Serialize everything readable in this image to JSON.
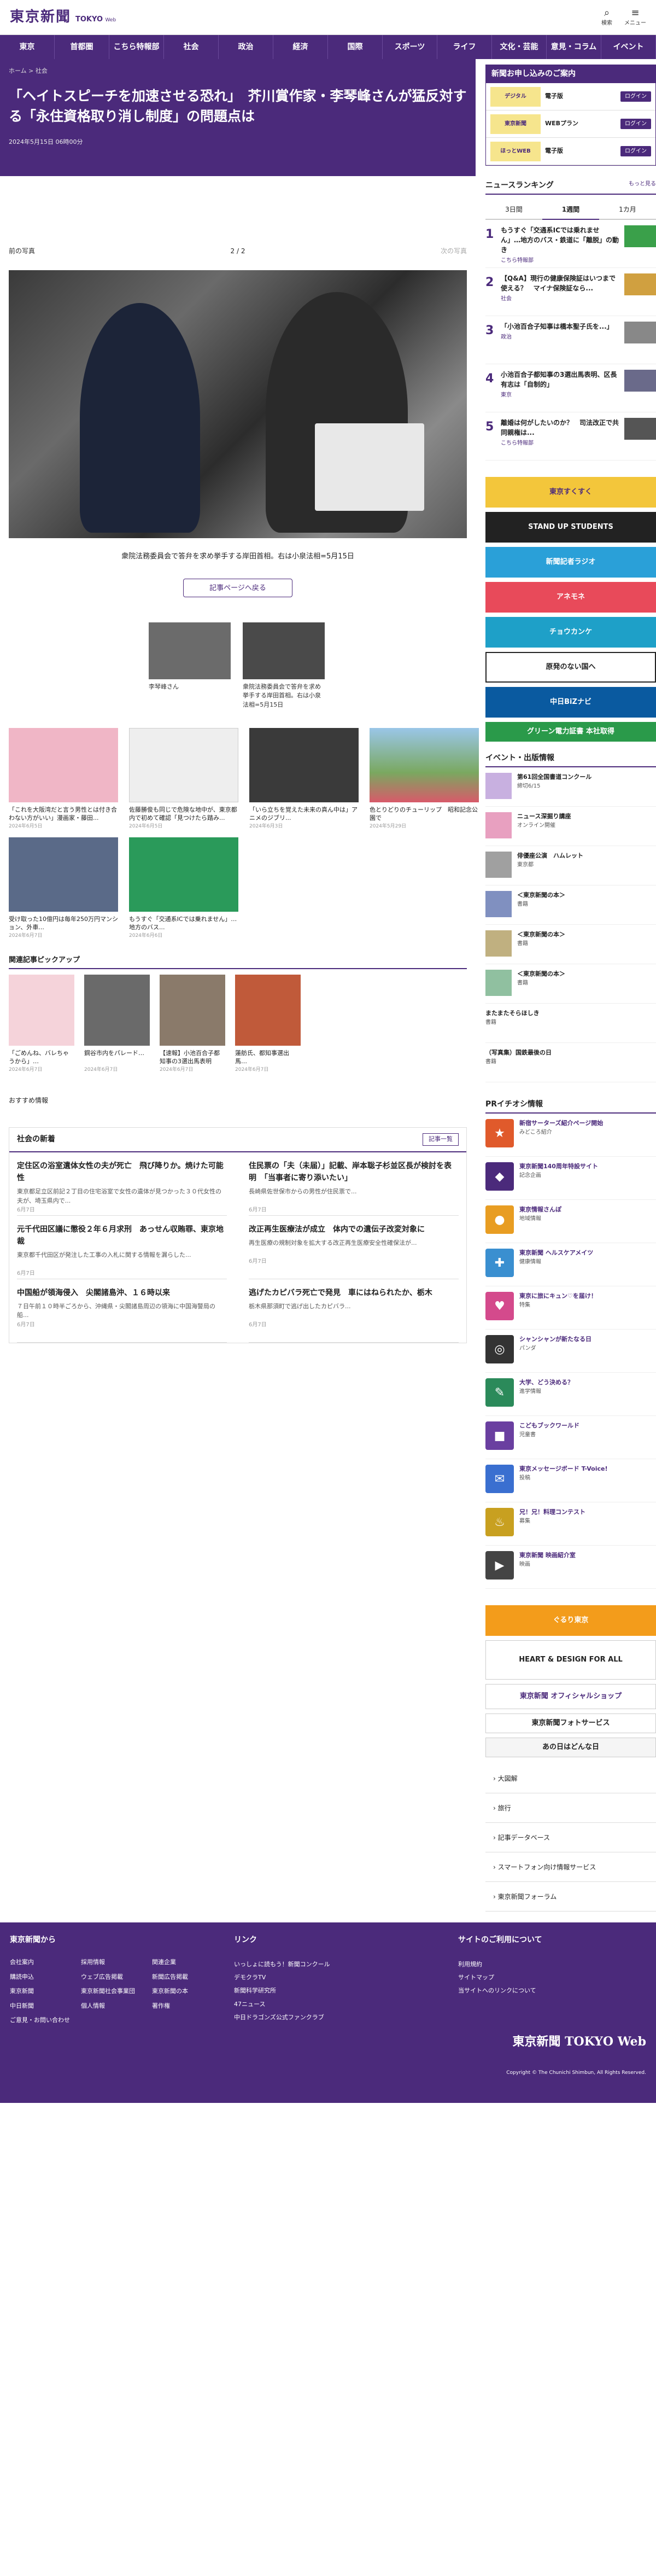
{
  "header": {
    "logo_jp": "東京新聞",
    "logo_en": "TOKYO",
    "logo_en_small": "Web",
    "search_label": "検索",
    "menu_label": "メニュー"
  },
  "nav": [
    "東京",
    "首都圏",
    "こちら特報部",
    "社会",
    "政治",
    "経済",
    "国際",
    "スポーツ",
    "ライフ",
    "文化・芸能",
    "意見・コラム",
    "イベント"
  ],
  "article": {
    "breadcrumb": "ホーム > 社会",
    "title": "「ヘイトスピーチを加速させる恐れ」　芥川賞作家・李琴峰さんが猛反対する「永住資格取り消し制度」の問題点は",
    "date": "2024年5月15日 06時00分",
    "prev": "前の写真",
    "page": "2 / 2",
    "next": "次の写真",
    "caption": "衆院法務委員会で答弁を求め挙手する岸田首相。右は小泉法相=5月15日",
    "back": "記事ページへ戻る"
  },
  "thumbs": [
    {
      "text": "李琴峰さん"
    },
    {
      "text": "衆院法務委員会で答弁を求め挙手する岸田首相。右は小泉法相=5月15日"
    }
  ],
  "related": [
    {
      "text": "「これを大阪湾だと言う男性とは付き合わない方がいい」漫画家・藤田...",
      "date": "2024年6月5日"
    },
    {
      "text": "佐藤勝俊も同じで危険な地中が、東京都内で初めて確認「見つけたら踏み...",
      "date": "2024年6月5日"
    },
    {
      "text": "「いら立ちを覚えた未来の真ん中は」アニメのジブリ...",
      "date": "2024年6月3日"
    },
    {
      "text": "色とりどりのチューリップ　昭和記念公園で",
      "date": "2024年5月29日"
    },
    {
      "text": "受け取った10億円は毎年250万円マンション、外車...",
      "date": "2024年6月7日"
    },
    {
      "text": "もうすぐ「交通系ICでは乗れません」…地方のバス...",
      "date": "2024年6月6日"
    }
  ],
  "pickup_title": "関連記事ピックアップ",
  "pickup": [
    {
      "text": "「ごめんね、バレちゃうから」…",
      "date": "2024年6月7日"
    },
    {
      "text": "鋼谷市内をパレード…",
      "date": "2024年6月7日"
    },
    {
      "text": "【速報】小池百合子都知事の3選出馬表明",
      "date": "2024年6月7日"
    },
    {
      "text": "蓮舫氏、都知事選出馬…",
      "date": "2024年6月7日"
    }
  ],
  "recommend_label": "おすすめ情報",
  "social": {
    "title": "社会の新着",
    "more": "記事一覧",
    "items": [
      {
        "title": "定住区の浴室遺体女性の夫が死亡　飛び降りか。焼けた可能性",
        "desc": "東京都足立区前記２丁目の住宅浴室で女性の遺体が見つかった３０代女性の夫が、埼玉県内で...",
        "date": "6月7日"
      },
      {
        "title": "住民票の「夫（未届）」記載、岸本聡子杉並区長が検討を表明　「当事者に寄り添いたい」",
        "desc": "長崎県佐世保市からの男性が住民票で...",
        "date": "6月7日"
      },
      {
        "title": "元千代田区議に懲役２年６月求刑　あっせん収賄罪、東京地裁",
        "desc": "東京都千代田区が発注した工事の入札に関する情報を漏らした...",
        "date": "6月7日"
      },
      {
        "title": "改正再生医療法が成立　体内での遺伝子改変対象に",
        "desc": "再生医療の規制対象を拡大する改正再生医療安全性確保法が...",
        "date": "6月7日"
      },
      {
        "title": "中国船が領海侵入　尖閣諸島沖、１６時以来",
        "desc": "７日午前１０時半ごろから、沖縄県・尖閣諸島周辺の領海に中国海警局の船...",
        "date": "6月7日"
      },
      {
        "title": "逃げたカピバラ死亡で発見　車にはねられたか、栃木",
        "desc": "栃木県那須町で逃げ出したカピバラ...",
        "date": "6月7日"
      }
    ]
  },
  "side": {
    "promo": {
      "title": "新聞お申し込みのご案内",
      "rows": [
        {
          "logo": "デジタル",
          "text": "電子版"
        },
        {
          "logo": "東京新聞",
          "text": "WEBプラン"
        },
        {
          "logo": "ほっとWEB",
          "text": "電子版"
        }
      ],
      "login": "ログイン"
    },
    "ranking": {
      "title": "ニュースランキング",
      "more": "もっと見る",
      "tabs": [
        "3日間",
        "1週間",
        "1カ月"
      ],
      "items": [
        {
          "n": "1",
          "t": "もうすぐ「交通系ICでは乗れません」…地方のバス・鉄道に「離脱」の動き",
          "c": "こちら特報部"
        },
        {
          "n": "2",
          "t": "【Q&A】現行の健康保険証はいつまで使える？　マイナ保険証なら...",
          "c": "社会"
        },
        {
          "n": "3",
          "t": "「小池百合子知事は橋本聖子氏を...」",
          "c": "政治"
        },
        {
          "n": "4",
          "t": "小池百合子都知事の3選出馬表明、区長有志は「自制的」",
          "c": "東京"
        },
        {
          "n": "5",
          "t": "離婚は何がしたいのか？　司法改正で共同親権は...",
          "c": "こちら特報部"
        }
      ]
    },
    "banners": [
      "東京すくすく",
      "STAND UP STUDENTS",
      "新聞記者ラジオ",
      "アネモネ",
      "チョウカンケ",
      "原発のない国へ",
      "中日BiZナビ",
      "グリーン電力証書 本社取得"
    ],
    "events_title": "イベント・出版情報",
    "events": [
      {
        "t": "第61回全国書道コンクール",
        "s": "締切6/15"
      },
      {
        "t": "ニュース深掘り講座",
        "s": "オンライン開催"
      },
      {
        "t": "俳優座公演　ハムレット",
        "s": "東京都"
      },
      {
        "t": "＜東京新聞の本＞",
        "s": "書籍"
      },
      {
        "t": "＜東京新聞の本＞",
        "s": "書籍"
      },
      {
        "t": "＜東京新聞の本＞",
        "s": "書籍"
      },
      {
        "t": "またまたそらほしき",
        "s": "書籍"
      },
      {
        "t": "（写真集）国鉄最後の日",
        "s": "書籍"
      }
    ],
    "pr_title": "PRイチオシ情報",
    "pr": [
      {
        "t": "新宿サーターズ紹介ページ開始",
        "s": "みどころ紹介",
        "icon": "★",
        "color": "#e05a2b"
      },
      {
        "t": "東京新聞140周年特設サイト",
        "s": "記念企画",
        "icon": "◆",
        "color": "#4b2a7b"
      },
      {
        "t": "東京情報さんぽ",
        "s": "地域情報",
        "icon": "●",
        "color": "#e89d22"
      },
      {
        "t": "東京新聞 ヘルスケアメイツ",
        "s": "健康情報",
        "icon": "✚",
        "color": "#3a8fd0"
      },
      {
        "t": "東京に旅にキュン♡を届け！",
        "s": "特集",
        "icon": "♥",
        "color": "#d44a8c"
      },
      {
        "t": "シャンシャンが新たなる日",
        "s": "パンダ",
        "icon": "◎",
        "color": "#333"
      },
      {
        "t": "大学、どう決める？",
        "s": "進学情報",
        "icon": "✎",
        "color": "#2b8a5a"
      },
      {
        "t": "こどもブックワールド",
        "s": "児童書",
        "icon": "■",
        "color": "#6a3fa0"
      },
      {
        "t": "東京メッセージボード T-Voice!",
        "s": "投稿",
        "icon": "✉",
        "color": "#3a6fd0"
      },
      {
        "t": "兄！兄！料理コンテスト",
        "s": "募集",
        "icon": "♨",
        "color": "#c8a020"
      },
      {
        "t": "東京新聞 映画紹介室",
        "s": "映画",
        "icon": "▶",
        "color": "#444"
      }
    ],
    "banners2": [
      "ぐるり東京",
      "HEART & DESIGN FOR ALL",
      "東京新聞 オフィシャルショップ",
      "東京新聞フォトサービス",
      "あの日はどんな日"
    ],
    "links": [
      "大図解",
      "旅行",
      "記事データベース",
      "スマートフォン向け情報サービス",
      "東京新聞フォーラム"
    ]
  },
  "footer": {
    "col1_title": "東京新聞から",
    "col1": [
      "会社案内",
      "採用情報",
      "関連企業",
      "購読申込",
      "ウェブ広告掲載",
      "新聞広告掲載",
      "東京新聞",
      "東京新聞社会事業団",
      "東京新聞の本",
      "中日新聞",
      "個人情報",
      "著作権",
      "ご意見・お問い合わせ"
    ],
    "col2_title": "リンク",
    "col2": [
      "いっしょに読もう！新聞コンクール",
      "デモクラTV",
      "新聞科学研究所",
      "47ニュース",
      "中日ドラゴンズ公式ファンクラブ"
    ],
    "col3_title": "サイトのご利用について",
    "col3": [
      "利用規約",
      "サイトマップ",
      "当サイトへのリンクについて"
    ],
    "copyright": "Copyright © The Chunichi Shimbun, All Rights Reserved.",
    "logo": "東京新聞 TOKYO Web"
  }
}
